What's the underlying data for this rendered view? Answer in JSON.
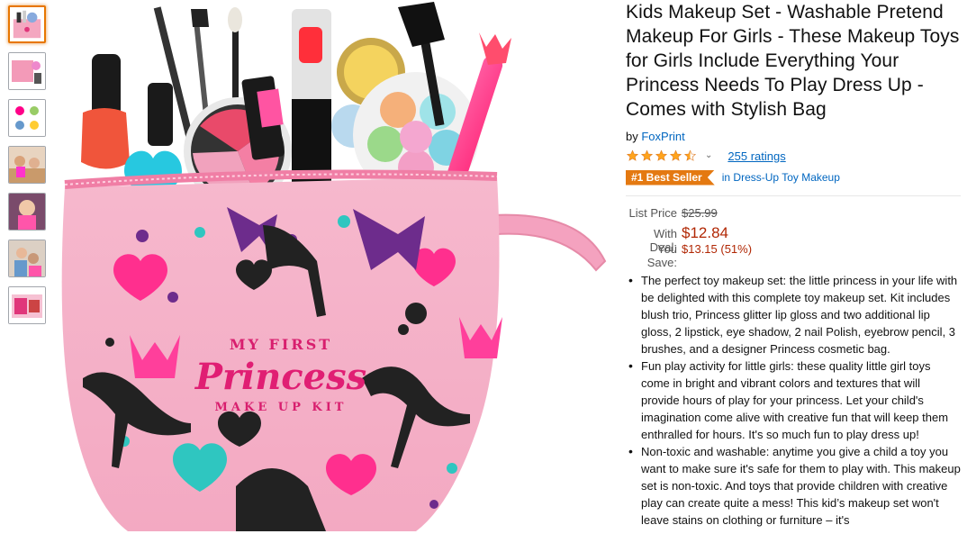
{
  "thumbnails": [
    {
      "name": "thumb-1",
      "selected": true
    },
    {
      "name": "thumb-2",
      "selected": false
    },
    {
      "name": "thumb-3",
      "selected": false
    },
    {
      "name": "thumb-4",
      "selected": false
    },
    {
      "name": "thumb-5",
      "selected": false
    },
    {
      "name": "thumb-6",
      "selected": false
    },
    {
      "name": "thumb-7",
      "selected": false
    }
  ],
  "main_image": {
    "bag_text_top": "MY FIRST",
    "bag_text_main": "Princess",
    "bag_text_bottom": "MAKE UP KIT"
  },
  "product": {
    "title": "Kids Makeup Set - Washable Pretend Makeup For Girls - These Makeup Toys for Girls Include Everything Your Princess Needs To Play Dress Up - Comes with Stylish Bag",
    "by_prefix": "by",
    "brand": "FoxPrint",
    "rating": 4.5,
    "ratings_count": "255 ratings",
    "badge": "#1 Best Seller",
    "badge_in": "in",
    "badge_category": "Dress-Up Toy Makeup"
  },
  "price": {
    "list_label": "List Price",
    "list_value": "$25.99",
    "deal_label": "With Deal:",
    "deal_value": "$12.84",
    "save_label": "You Save:",
    "save_value": "$13.15 (51%)"
  },
  "bullets": [
    "The perfect toy makeup set: the little princess in your life with be delighted with this complete toy makeup set. Kit includes blush trio, Princess glitter lip gloss and two additional lip gloss, 2 lipstick, eye shadow, 2 nail Polish, eyebrow pencil, 3 brushes, and a designer Princess cosmetic bag.",
    "Fun play activity for little girls: these quality little girl toys come in bright and vibrant colors and textures that will provide hours of play for your princess. Let your child's imagination come alive with creative fun that will keep them enthralled for hours. It's so much fun to play dress up!",
    "Non-toxic and washable: anytime you give a child a toy you want to make sure it's safe for them to play with. This makeup set is non-toxic. And toys that provide children with creative play can create quite a mess! This kid’s makeup set won't leave stains on clothing or furniture – it's"
  ],
  "colors": {
    "link": "#0066c0",
    "price": "#b12704",
    "badge": "#e47911",
    "star": "#ffa41c",
    "selected_border": "#e77600"
  }
}
